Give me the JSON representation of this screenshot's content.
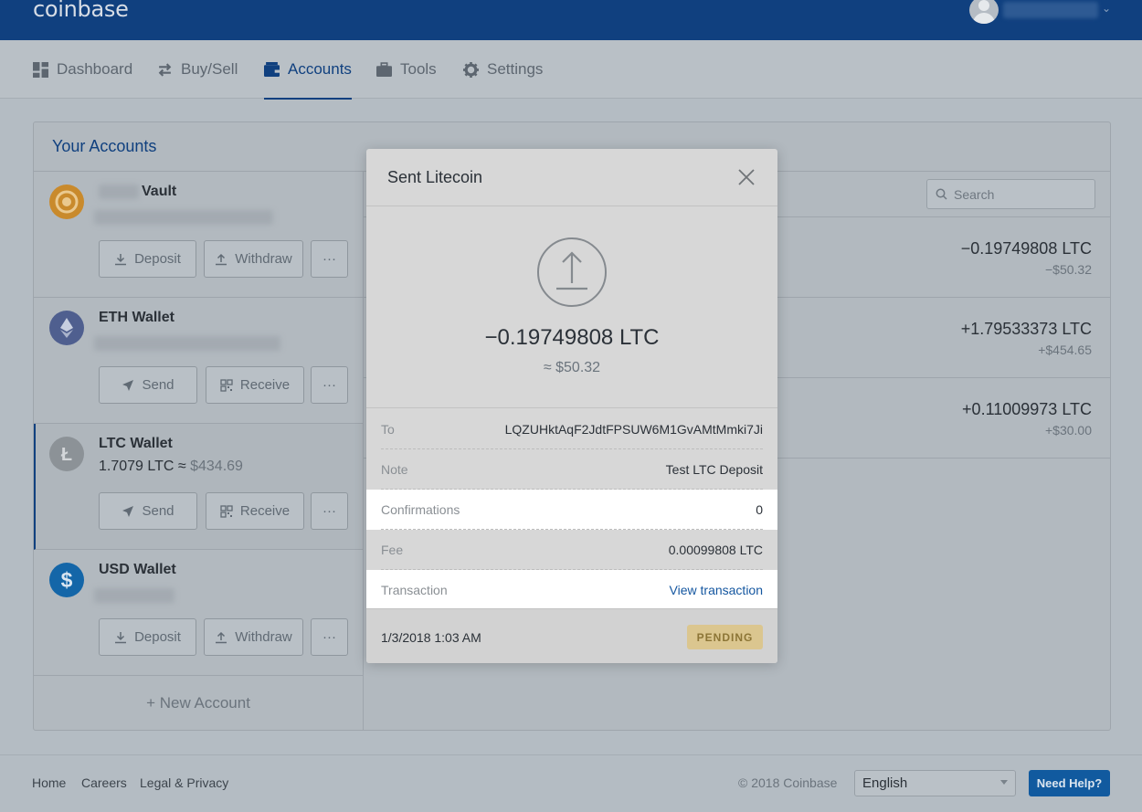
{
  "header": {
    "logo": "coinbase"
  },
  "nav": {
    "items": [
      {
        "label": "Dashboard",
        "icon": "dashboard-icon"
      },
      {
        "label": "Buy/Sell",
        "icon": "swap-icon"
      },
      {
        "label": "Accounts",
        "icon": "wallet-icon",
        "active": true
      },
      {
        "label": "Tools",
        "icon": "briefcase-icon"
      },
      {
        "label": "Settings",
        "icon": "gear-icon"
      }
    ]
  },
  "accounts": {
    "title": "Your Accounts",
    "list": [
      {
        "name": "Vault",
        "icon": "vault-icon",
        "color": "#c98a2c",
        "buttons": [
          "Deposit",
          "Withdraw",
          "···"
        ]
      },
      {
        "name": "ETH Wallet",
        "icon": "ethereum-icon",
        "color": "#4f5f8f",
        "buttons": [
          "Send",
          "Receive",
          "···"
        ]
      },
      {
        "name": "LTC Wallet",
        "icon": "litecoin-icon",
        "color": "#8c9297",
        "balance": "1.7079 LTC ≈",
        "balance_fiat": "$434.69",
        "buttons": [
          "Send",
          "Receive",
          "···"
        ]
      },
      {
        "name": "USD Wallet",
        "icon": "dollar-icon",
        "color": "#1466a8",
        "buttons": [
          "Deposit",
          "Withdraw",
          "···"
        ]
      }
    ],
    "new_account": "+ New Account"
  },
  "transactions": {
    "search_placeholder": "Search",
    "rows": [
      {
        "amount": "−0.19749808 LTC",
        "fiat": "−$50.32"
      },
      {
        "amount": "+1.79533373 LTC",
        "fiat": "+$454.65"
      },
      {
        "amount": "+0.11009973 LTC",
        "fiat": "+$30.00"
      }
    ]
  },
  "modal": {
    "title": "Sent Litecoin",
    "amount": "−0.19749808 LTC",
    "fiat": "≈ $50.32",
    "details": [
      {
        "label": "To",
        "value": "LQZUHktAqF2JdtFPSUW6M1GvAMtMmki7Ji"
      },
      {
        "label": "Note",
        "value": "Test LTC Deposit"
      },
      {
        "label": "Confirmations",
        "value": "0"
      },
      {
        "label": "Fee",
        "value": "0.00099808 LTC"
      },
      {
        "label": "Transaction",
        "value": "View transaction"
      }
    ],
    "date": "1/3/2018 1:03 AM",
    "status": "PENDING"
  },
  "footer": {
    "links": [
      "Home",
      "Careers",
      "Legal & Privacy"
    ],
    "copyright": "© 2018 Coinbase",
    "language": "English",
    "help": "Need Help?"
  }
}
